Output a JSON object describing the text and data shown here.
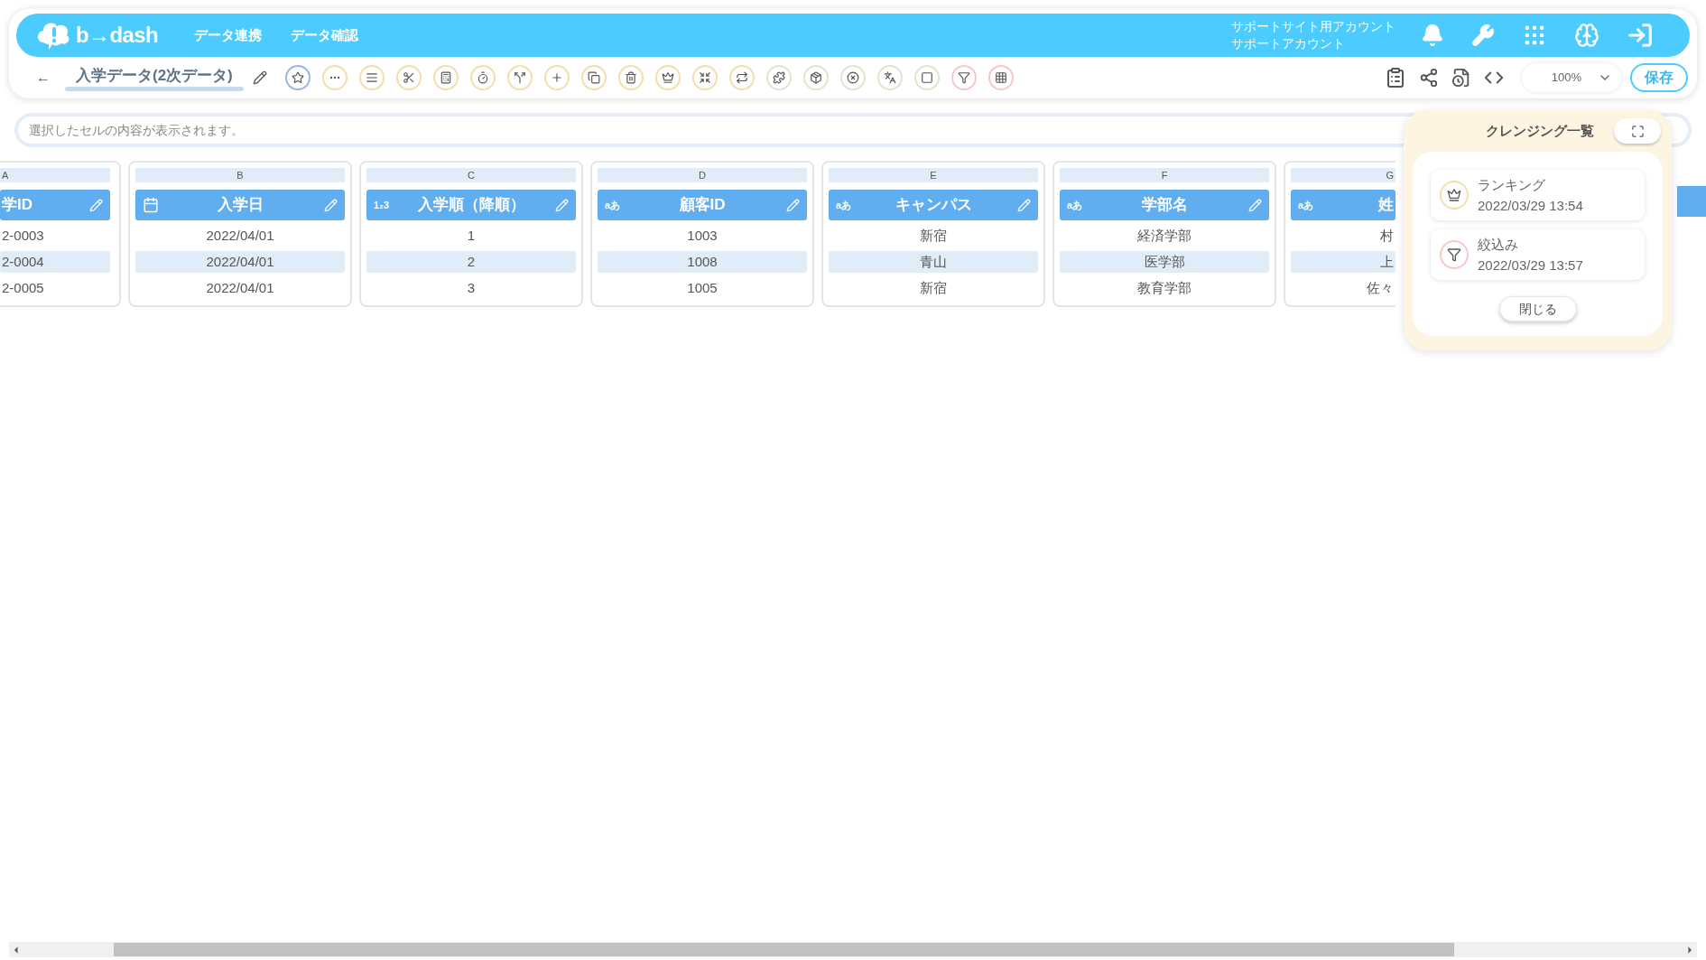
{
  "header": {
    "logo": "b→dash",
    "nav": [
      "データ連携",
      "データ確認"
    ],
    "account": [
      "サポートサイト用アカウント",
      "サポートアカウント"
    ]
  },
  "toolbar": {
    "back": "←",
    "title": "入学データ(2次データ)",
    "tools": [
      {
        "kind": "star",
        "color": "#9ab8dc"
      },
      {
        "kind": "dots",
        "color": "#f3dfae"
      },
      {
        "kind": "lines",
        "color": "#f3dfae"
      },
      {
        "kind": "scissors",
        "color": "#f3dfae"
      },
      {
        "kind": "calc",
        "color": "#f3dfae"
      },
      {
        "kind": "timer",
        "color": "#f3dfae"
      },
      {
        "kind": "split",
        "color": "#f3dfae"
      },
      {
        "kind": "plus",
        "color": "#f3dfae"
      },
      {
        "kind": "copy",
        "color": "#f3dfae"
      },
      {
        "kind": "trash",
        "color": "#f3dfae"
      },
      {
        "kind": "crown",
        "color": "#f3dfae"
      },
      {
        "kind": "shrink",
        "color": "#f3dfae"
      },
      {
        "kind": "repeat",
        "color": "#f3dfae"
      },
      {
        "kind": "puzzle",
        "color": "#dfe6cf"
      },
      {
        "kind": "package",
        "color": "#dfe6cf"
      },
      {
        "kind": "xcircle",
        "color": "#dfe6cf"
      },
      {
        "kind": "translate",
        "color": "#dfe6cf"
      },
      {
        "kind": "square",
        "color": "#dfe6cf"
      },
      {
        "kind": "filter",
        "color": "#f6c9c9"
      },
      {
        "kind": "grid",
        "color": "#f6c9c9"
      }
    ],
    "zoom": "100%",
    "save": "保存"
  },
  "search": {
    "placeholder": "選択したセルの内容が表示されます。"
  },
  "columns": [
    {
      "letter": "A",
      "name": "学ID",
      "cells": [
        "2-0003",
        "2-0004",
        "2-0005"
      ]
    },
    {
      "letter": "B",
      "name": "入学日",
      "type": {
        "kind": "date"
      },
      "cells": [
        "2022/04/01",
        "2022/04/01",
        "2022/04/01"
      ]
    },
    {
      "letter": "C",
      "name": "入学順（降順）",
      "type": {
        "kind": "number",
        "label": "1₂3"
      },
      "cells": [
        "1",
        "2",
        "3"
      ]
    },
    {
      "letter": "D",
      "name": "顧客ID",
      "type": {
        "kind": "text",
        "label": "aあ"
      },
      "cells": [
        "1003",
        "1008",
        "1005"
      ]
    },
    {
      "letter": "E",
      "name": "キャンパス",
      "type": {
        "kind": "text",
        "label": "aあ"
      },
      "cells": [
        "新宿",
        "青山",
        "新宿"
      ]
    },
    {
      "letter": "F",
      "name": "学部名",
      "type": {
        "kind": "text",
        "label": "aあ"
      },
      "cells": [
        "経済学部",
        "医学部",
        "教育学部"
      ]
    },
    {
      "letter": "G",
      "name": "姓",
      "type": {
        "kind": "text",
        "label": "aあ"
      },
      "cells": [
        "村",
        "上",
        "佐々"
      ]
    }
  ],
  "cleansing_panel": {
    "title": "クレンジング一覧",
    "items": [
      {
        "kind": "crown",
        "color": "#f3dfae",
        "name": "ランキング",
        "date": "2022/03/29 13:54"
      },
      {
        "kind": "filter",
        "color": "#f6c9c9",
        "name": "絞込み",
        "date": "2022/03/29 13:57"
      }
    ],
    "close": "閉じる"
  }
}
